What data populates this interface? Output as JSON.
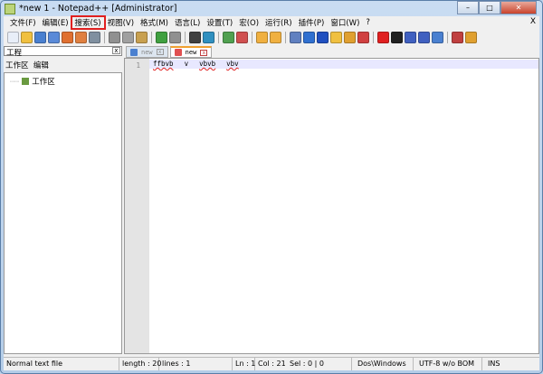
{
  "window": {
    "title": "*new  1 - Notepad++ [Administrator]",
    "min": "–",
    "max": "□",
    "close": "✕"
  },
  "menu": {
    "items": [
      "文件(F)",
      "编辑(E)",
      "搜索(S)",
      "视图(V)",
      "格式(M)",
      "语言(L)",
      "设置(T)",
      "宏(O)",
      "运行(R)",
      "插件(P)",
      "窗口(W)",
      "?"
    ],
    "close": "X",
    "highlighted": "搜索(S)"
  },
  "toolbar": {
    "icons": [
      {
        "n": "new-file-icon",
        "c": "#e8eef8"
      },
      {
        "n": "open-file-icon",
        "c": "#f0c040"
      },
      {
        "n": "save-icon",
        "c": "#4a80d0"
      },
      {
        "n": "save-all-icon",
        "c": "#5a8ad8"
      },
      {
        "n": "close-icon",
        "c": "#e07030"
      },
      {
        "n": "close-all-icon",
        "c": "#e08040"
      },
      {
        "n": "print-icon",
        "c": "#8090a0"
      },
      {
        "sep": true
      },
      {
        "n": "cut-icon",
        "c": "#909090"
      },
      {
        "n": "copy-icon",
        "c": "#a0a0a0"
      },
      {
        "n": "paste-icon",
        "c": "#c8a050"
      },
      {
        "sep": true
      },
      {
        "n": "undo-icon",
        "c": "#40a040"
      },
      {
        "n": "redo-icon",
        "c": "#909090"
      },
      {
        "sep": true
      },
      {
        "n": "find-icon",
        "c": "#404040"
      },
      {
        "n": "replace-icon",
        "c": "#3090c0"
      },
      {
        "sep": true
      },
      {
        "n": "zoom-in-icon",
        "c": "#50a050"
      },
      {
        "n": "zoom-out-icon",
        "c": "#d05050"
      },
      {
        "sep": true
      },
      {
        "n": "sync-v-icon",
        "c": "#f0b040"
      },
      {
        "n": "sync-h-icon",
        "c": "#f0b040"
      },
      {
        "sep": true
      },
      {
        "n": "word-wrap-icon",
        "c": "#6080c0"
      },
      {
        "n": "show-all-chars-icon",
        "c": "#3070d0"
      },
      {
        "n": "indent-guide-icon",
        "c": "#2050c0"
      },
      {
        "n": "folder-icon",
        "c": "#f0c040"
      },
      {
        "n": "doc-map-icon",
        "c": "#e0a030"
      },
      {
        "n": "function-list-icon",
        "c": "#d04040"
      },
      {
        "sep": true
      },
      {
        "n": "record-macro-icon",
        "c": "#e02020"
      },
      {
        "n": "stop-record-icon",
        "c": "#202020"
      },
      {
        "n": "play-macro-icon",
        "c": "#4060c0"
      },
      {
        "n": "play-multi-icon",
        "c": "#4060c0"
      },
      {
        "n": "save-macro-icon",
        "c": "#4a80d0"
      },
      {
        "sep": true
      },
      {
        "n": "spell-check-icon",
        "c": "#c04040"
      },
      {
        "n": "plugin-icon",
        "c": "#e0a030"
      }
    ]
  },
  "panel": {
    "title": "工程",
    "close": "x",
    "menu": [
      "工作区",
      "编辑"
    ],
    "tree_item": "工作区"
  },
  "tabs": [
    {
      "label": "new",
      "active": false,
      "icon_color": "#4a80d0"
    },
    {
      "label": "new",
      "active": true,
      "icon_color": "#e05050"
    }
  ],
  "editor": {
    "line_number": "1",
    "tokens": [
      "ffbvb",
      "v",
      "vbvb",
      "vbv"
    ]
  },
  "status": {
    "type": "Normal text file",
    "length": "length : 20",
    "lines": "lines : 1",
    "ln": "Ln : 1",
    "col": "Col : 21",
    "sel": "Sel : 0 | 0",
    "eol": "Dos\\Windows",
    "encoding": "UTF-8 w/o BOM",
    "mode": "INS"
  }
}
